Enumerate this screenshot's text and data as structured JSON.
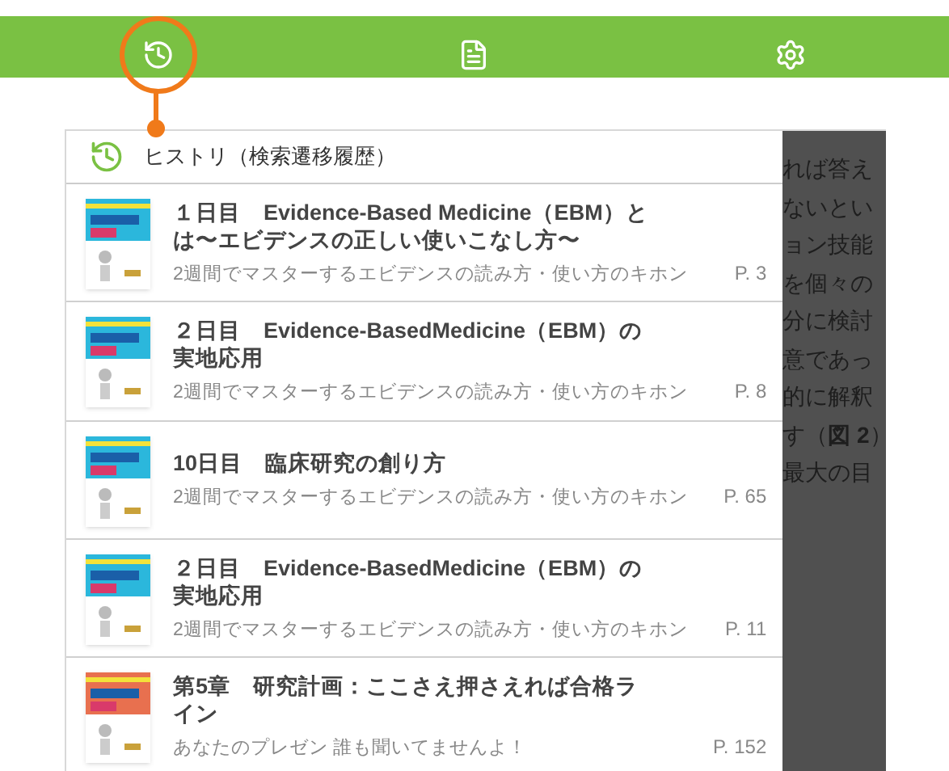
{
  "toolbar": {
    "tabs": [
      {
        "kind": "history",
        "selected": true
      },
      {
        "kind": "document",
        "selected": false
      },
      {
        "kind": "settings",
        "selected": false
      }
    ]
  },
  "history_panel": {
    "title": "ヒストリ（検索遷移履歴）",
    "items": [
      {
        "title": "１日目　Evidence-Based Medicine（EBM）とは〜エビデンスの正しい使いこなし方〜",
        "book": "2週間でマスターするエビデンスの読み方・使い方のキホン",
        "page": "P. 3",
        "color": "#2bb7dc"
      },
      {
        "title": "２日目　Evidence-BasedMedicine（EBM）の実地応用",
        "book": "2週間でマスターするエビデンスの読み方・使い方のキホン",
        "page": "P. 8",
        "color": "#2bb7dc"
      },
      {
        "title": "10日目　臨床研究の創り方",
        "book": "2週間でマスターするエビデンスの読み方・使い方のキホン",
        "page": "P. 65",
        "color": "#2bb7dc"
      },
      {
        "title": "２日目　Evidence-BasedMedicine（EBM）の実地応用",
        "book": "2週間でマスターするエビデンスの読み方・使い方のキホン",
        "page": "P. 11",
        "color": "#2bb7dc"
      },
      {
        "title": "第5章　研究計画：ここさえ押さえれば合格ライン",
        "book": "あなたのプレゼン 誰も聞いてませんよ！",
        "page": "P. 152",
        "color": "#e8704f"
      }
    ]
  },
  "background_text": [
    "れば答え",
    "ないとい",
    "ョン技能",
    "を個々の",
    "分に検討",
    "意であっ",
    "的に解釈",
    "す（**図 2**）",
    "最大の目"
  ]
}
